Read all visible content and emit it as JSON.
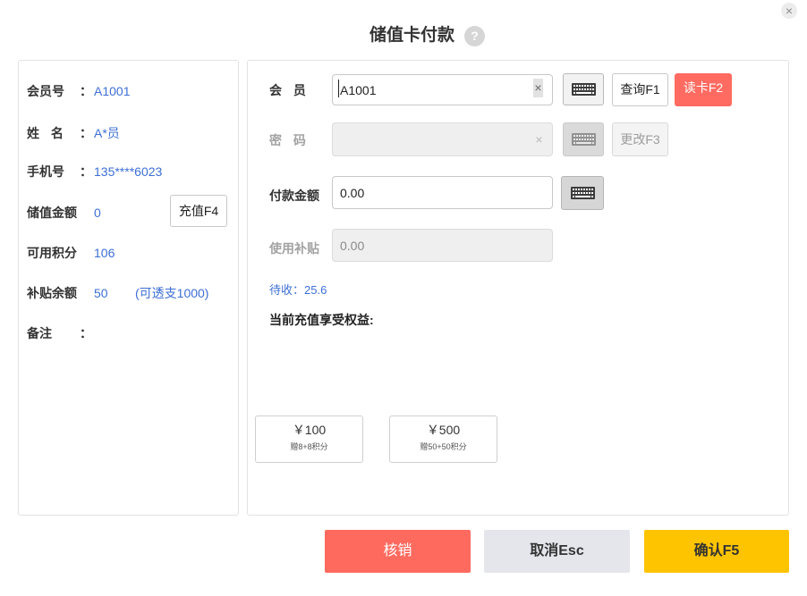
{
  "dialog": {
    "title": "储值卡付款",
    "help_glyph": "?",
    "close_glyph": "×"
  },
  "member_info": {
    "member_id": {
      "label": "会员号",
      "colon": "：",
      "value": "A1001"
    },
    "name": {
      "label": "姓 名",
      "colon": "：",
      "value": "A*员"
    },
    "phone": {
      "label": "手机号",
      "colon": "：",
      "value": "135****6023"
    },
    "stored_balance": {
      "label": "储值金额",
      "value": "0"
    },
    "recharge_button": "充值F4",
    "points": {
      "label": "可用积分",
      "value": "106"
    },
    "subsidy_balance": {
      "label": "补贴余额",
      "value": "50",
      "overdraft": "(可透支1000)"
    },
    "remark": {
      "label": "备注",
      "colon": "："
    }
  },
  "payment_form": {
    "member": {
      "label": "会 员",
      "value": "A1001",
      "clear_glyph": "×"
    },
    "query_button": "查询F1",
    "read_card_button": "读卡F2",
    "password": {
      "label": "密 码",
      "clear_glyph": "×",
      "disabled": true
    },
    "change_password_button": "更改F3",
    "amount": {
      "label": "付款金额",
      "value": "0.00"
    },
    "subsidy": {
      "label": "使用补贴",
      "value": "0.00",
      "disabled": true
    },
    "pending_text": "待收：25.6",
    "benefits_title": "当前充值享受权益:",
    "benefit_cards": [
      {
        "amount": "￥100",
        "bonus": "赠8+8积分"
      },
      {
        "amount": "￥500",
        "bonus": "赠50+50积分"
      }
    ]
  },
  "actions": {
    "writeoff_button": "核销",
    "cancel_button": "取消Esc",
    "confirm_button": "确认F5"
  },
  "colors": {
    "value_text": "#3d6fd4",
    "read_card_button": "#ff6b61",
    "writeoff_button": "#ff6a5f",
    "cancel_button": "#e4e6eb",
    "confirm_button": "#ffc400"
  },
  "icons": {
    "close": "close-icon",
    "help": "help-icon",
    "keyboard": "keyboard-icon",
    "clear": "clear-icon"
  }
}
